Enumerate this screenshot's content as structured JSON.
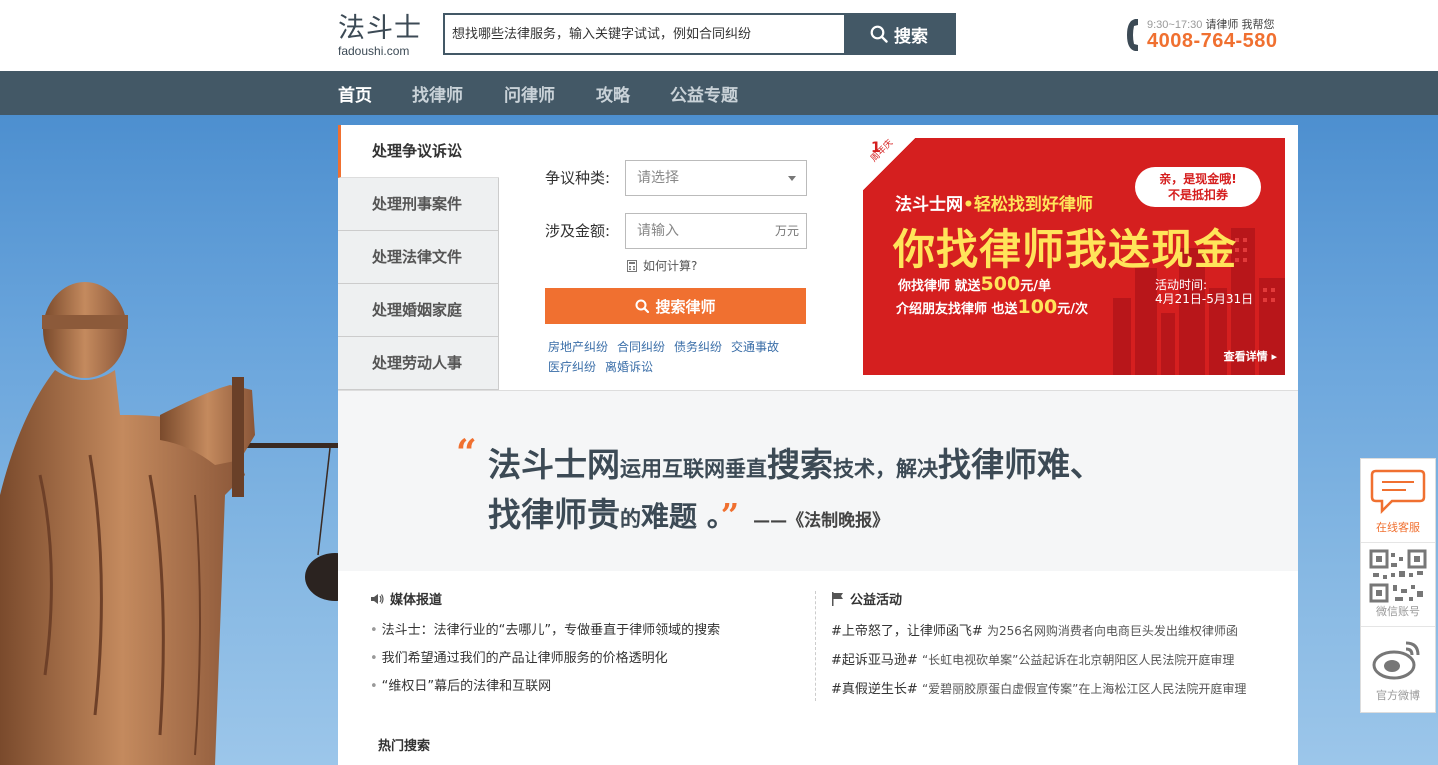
{
  "header": {
    "logo_cn": "法斗士",
    "logo_en": "fadoushi.com",
    "search_placeholder": "想找哪些法律服务，输入关键字试试，例如合同纠纷",
    "search_button": "搜索",
    "hotline_hours": "9:30~17:30",
    "hotline_link1": "请律师",
    "hotline_link2": "我帮您",
    "hotline_number": "4008-764-580"
  },
  "nav": {
    "items": [
      "首页",
      "找律师",
      "问律师",
      "攻略",
      "公益专题"
    ]
  },
  "tabs": [
    "处理争议诉讼",
    "处理刑事案件",
    "处理法律文件",
    "处理婚姻家庭",
    "处理劳动人事"
  ],
  "form": {
    "type_label": "争议种类:",
    "type_placeholder": "请选择",
    "amount_label": "涉及金额:",
    "amount_placeholder": "请输入",
    "amount_unit": "万元",
    "calc_link": "如何计算?",
    "submit": "搜索律师",
    "quick_links": [
      "房地产纠纷",
      "合同纠纷",
      "债务纠纷",
      "交通事故",
      "医疗纠纷",
      "离婚诉讼"
    ]
  },
  "banner": {
    "corner_num": "1",
    "corner_text": "周年庆",
    "line1_a": "法斗士网",
    "line1_dot": "•",
    "line1_b": "轻松找到好律师",
    "bubble1": "亲，是现金哦!",
    "bubble2": "不是抵扣券",
    "headline": "你找律师我送现金",
    "line3_a": "你找律师 就送",
    "line3_num": "500",
    "line3_b": "元/单",
    "line4_a": "介绍朋友找律师 也送",
    "line4_num": "100",
    "line4_b": "元/次",
    "time_label": "活动时间:",
    "time_value": "4月21日-5月31日",
    "detail": "查看详情 ▸"
  },
  "quote": {
    "open_mark": "“",
    "p1": "法斗士网",
    "p2": "运用",
    "p3": "互联网垂直",
    "p4": "搜索",
    "p5": "技术，解决",
    "p6": "找律师难、",
    "p7": "找律师贵",
    "p8": "的",
    "p9": "难题 。",
    "close_mark": "”",
    "source": "——《法制晚报》"
  },
  "news": {
    "media_title": "媒体报道",
    "media_items": [
      "法斗士：法律行业的“去哪儿”，专做垂直于律师领域的搜索",
      "我们希望通过我们的产品让律师服务的价格透明化",
      "“维权日”幕后的法律和互联网"
    ],
    "charity_title": "公益活动",
    "charity_items": [
      {
        "tag": "#上帝怒了，让律师函飞#",
        "text": "为256名网购消费者向电商巨头发出维权律师函"
      },
      {
        "tag": "#起诉亚马逊#",
        "text": "“长虹电视砍单案”公益起诉在北京朝阳区人民法院开庭审理"
      },
      {
        "tag": "#真假逆生长#",
        "text": "“爱碧丽胶原蛋白虚假宣传案”在上海松江区人民法院开庭审理"
      }
    ],
    "hot_title": "热门搜索"
  },
  "float": {
    "service": "在线客服",
    "wechat": "微信账号",
    "weibo": "官方微博"
  },
  "colors": {
    "nav_bg": "#435866",
    "accent": "#f07030",
    "banner_red": "#d51f1f",
    "banner_yellow": "#ffe45a"
  }
}
